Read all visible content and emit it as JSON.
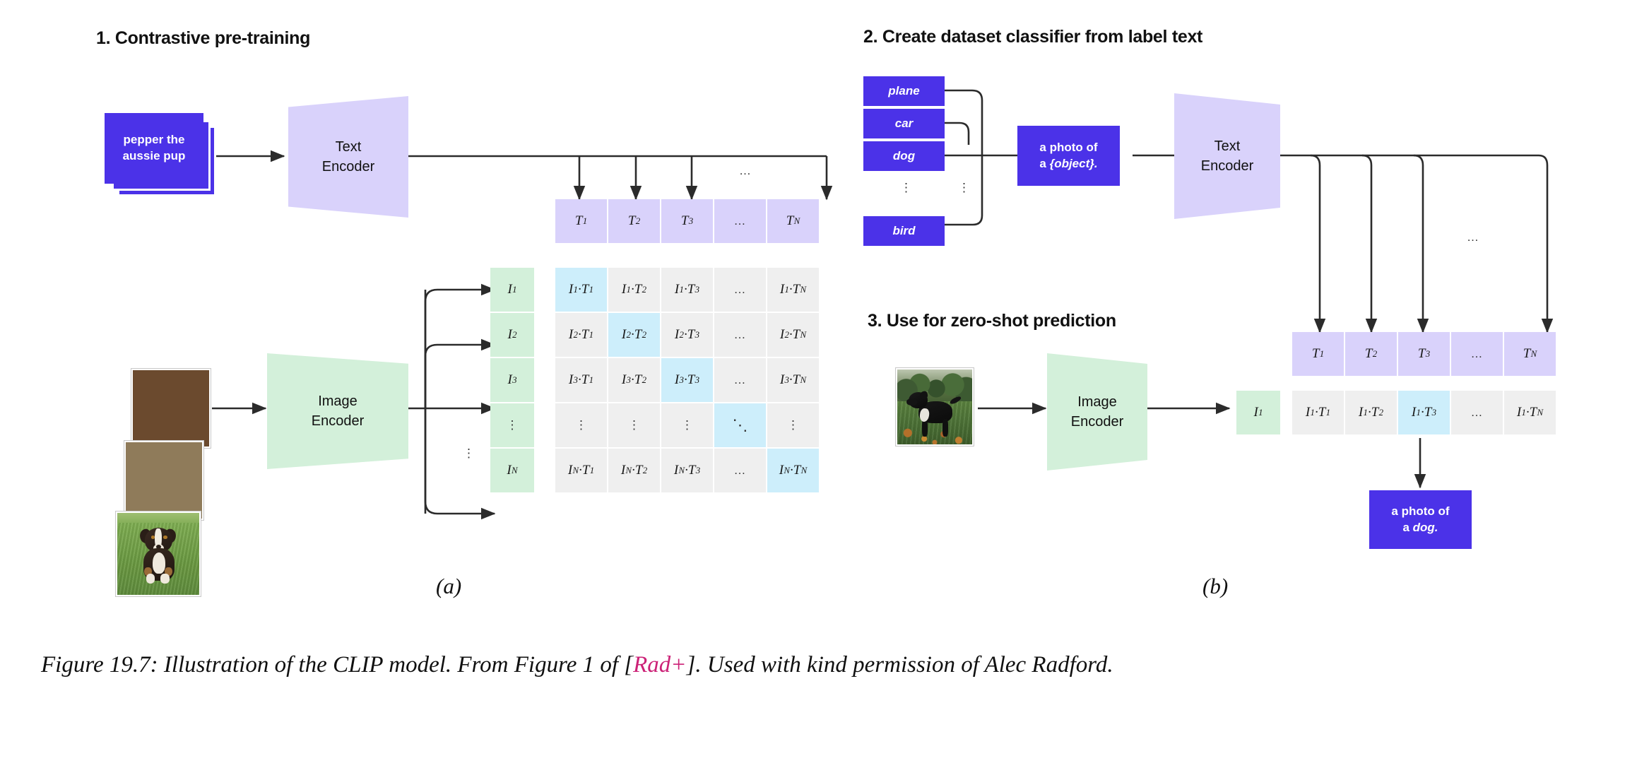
{
  "figure": {
    "caption_pre": "Figure 19.7: Illustration of the CLIP model. From Figure 1 of [",
    "caption_cite": "Rad+",
    "caption_post": "]. Used with kind permission of Alec Radford.",
    "subfig_a": "(a)",
    "subfig_b": "(b)"
  },
  "colors": {
    "blue_card": "#4b32e8",
    "lavender": "#d9d2fb",
    "green": "#d3f0da",
    "grey_cell": "#efefef",
    "highlight": "#cdeefb",
    "citation": "#cc2277",
    "arrow": "#2b2b2b"
  },
  "panel1": {
    "title": "1. Contrastive pre-training",
    "text_card_line1": "pepper the",
    "text_card_line2": "aussie pup",
    "text_encoder": {
      "line1": "Text",
      "line2": "Encoder"
    },
    "image_encoder": {
      "line1": "Image",
      "line2": "Encoder"
    },
    "image_alt": "stack of photos of an australian shepherd puppy on grass",
    "t_row": [
      {
        "base": "T",
        "sub": "1"
      },
      {
        "base": "T",
        "sub": "2"
      },
      {
        "base": "T",
        "sub": "3"
      },
      {
        "base": "…",
        "sub": ""
      },
      {
        "base": "T",
        "sub": "N"
      }
    ],
    "i_col": [
      {
        "base": "I",
        "sub": "1"
      },
      {
        "base": "I",
        "sub": "2"
      },
      {
        "base": "I",
        "sub": "3"
      },
      {
        "base": "⋮",
        "sub": ""
      },
      {
        "base": "I",
        "sub": "N"
      }
    ],
    "col_ellipsis_top": "…",
    "row_ellipsis_left": "⋮",
    "matrix": [
      [
        {
          "text": "I₁·T₁",
          "i": "1",
          "t": "1",
          "kind": "hl"
        },
        {
          "text": "I₁·T₂",
          "i": "1",
          "t": "2",
          "kind": "plain"
        },
        {
          "text": "I₁·T₃",
          "i": "1",
          "t": "3",
          "kind": "plain"
        },
        {
          "text": "…",
          "i": "",
          "t": "",
          "kind": "dots-h"
        },
        {
          "text": "I₁·Tₙ",
          "i": "1",
          "t": "N",
          "kind": "plain"
        }
      ],
      [
        {
          "text": "I₂·T₁",
          "i": "2",
          "t": "1",
          "kind": "plain"
        },
        {
          "text": "I₂·T₂",
          "i": "2",
          "t": "2",
          "kind": "hl"
        },
        {
          "text": "I₂·T₃",
          "i": "2",
          "t": "3",
          "kind": "plain"
        },
        {
          "text": "…",
          "i": "",
          "t": "",
          "kind": "dots-h"
        },
        {
          "text": "I₂·Tₙ",
          "i": "2",
          "t": "N",
          "kind": "plain"
        }
      ],
      [
        {
          "text": "I₃·T₁",
          "i": "3",
          "t": "1",
          "kind": "plain"
        },
        {
          "text": "I₃·T₂",
          "i": "3",
          "t": "2",
          "kind": "plain"
        },
        {
          "text": "I₃·T₃",
          "i": "3",
          "t": "3",
          "kind": "hl"
        },
        {
          "text": "…",
          "i": "",
          "t": "",
          "kind": "dots-h"
        },
        {
          "text": "I₃·Tₙ",
          "i": "3",
          "t": "N",
          "kind": "plain"
        }
      ],
      [
        {
          "text": "⋮",
          "i": "",
          "t": "",
          "kind": "dots-v"
        },
        {
          "text": "⋮",
          "i": "",
          "t": "",
          "kind": "dots-v"
        },
        {
          "text": "⋮",
          "i": "",
          "t": "",
          "kind": "dots-v"
        },
        {
          "text": "⋱",
          "i": "",
          "t": "",
          "kind": "dots-diag-hl"
        },
        {
          "text": "⋮",
          "i": "",
          "t": "",
          "kind": "dots-v"
        }
      ],
      [
        {
          "text": "Iₙ·T₁",
          "i": "N",
          "t": "1",
          "kind": "plain"
        },
        {
          "text": "Iₙ·T₂",
          "i": "N",
          "t": "2",
          "kind": "plain"
        },
        {
          "text": "Iₙ·T₃",
          "i": "N",
          "t": "3",
          "kind": "plain"
        },
        {
          "text": "…",
          "i": "",
          "t": "",
          "kind": "dots-h"
        },
        {
          "text": "Iₙ·Tₙ",
          "i": "N",
          "t": "N",
          "kind": "hl"
        }
      ]
    ]
  },
  "panel2": {
    "title": "2. Create dataset classifier from label text",
    "labels": [
      "plane",
      "car",
      "dog",
      "bird"
    ],
    "labels_ellipsis": "⋮",
    "branch_ellipsis": "⋮",
    "prompt_line1": "a photo of",
    "prompt_line2_pre": "a ",
    "prompt_line2_obj": "{object}.",
    "text_encoder": {
      "line1": "Text",
      "line2": "Encoder"
    },
    "col_ellipsis": "…",
    "t_row": [
      {
        "base": "T",
        "sub": "1"
      },
      {
        "base": "T",
        "sub": "2"
      },
      {
        "base": "T",
        "sub": "3"
      },
      {
        "base": "…",
        "sub": ""
      },
      {
        "base": "T",
        "sub": "N"
      }
    ]
  },
  "panel3": {
    "title": "3. Use for zero-shot prediction",
    "image_alt": "photo of a black dog standing in a grassy field with autumn leaves",
    "image_encoder": {
      "line1": "Image",
      "line2": "Encoder"
    },
    "i_box": {
      "base": "I",
      "sub": "1"
    },
    "score_row": [
      {
        "text": "I₁·T₁",
        "kind": "plain"
      },
      {
        "text": "I₁·T₂",
        "kind": "plain"
      },
      {
        "text": "I₁·T₃",
        "kind": "hl"
      },
      {
        "text": "…",
        "kind": "dots-h"
      },
      {
        "text": "I₁·Tₙ",
        "kind": "plain"
      }
    ],
    "result_line1": "a photo of",
    "result_line2_pre": "a ",
    "result_line2_obj": "dog."
  }
}
